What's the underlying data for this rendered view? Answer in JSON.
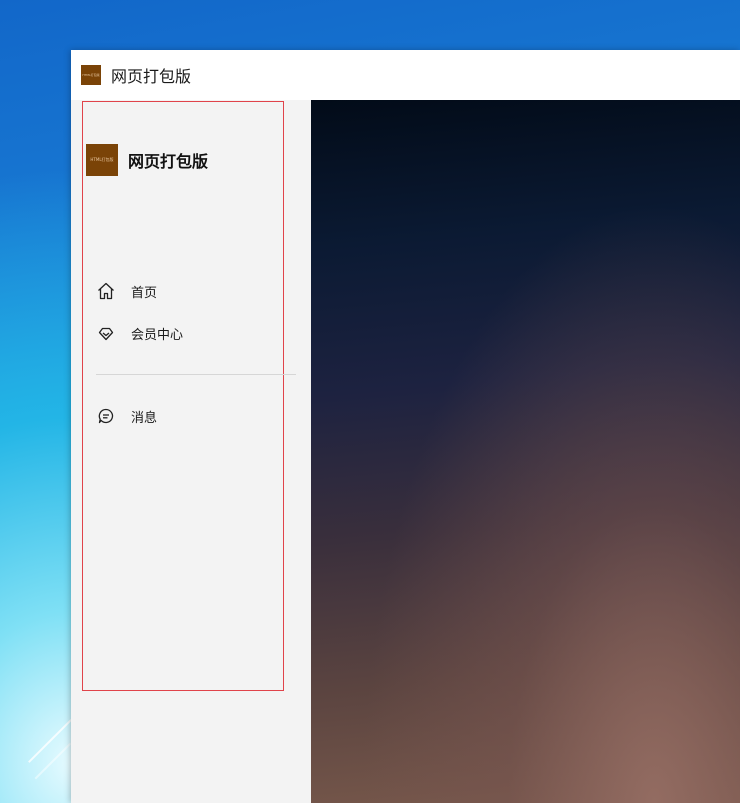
{
  "window": {
    "title": "网页打包版",
    "icon_text": "HTML打包版"
  },
  "sidebar": {
    "brand": {
      "logo_text": "HTML打包版",
      "name": "网页打包版"
    },
    "items": [
      {
        "label": "首页",
        "icon": "home-icon"
      },
      {
        "label": "会员中心",
        "icon": "diamond-icon"
      },
      {
        "label": "消息",
        "icon": "chat-bubble-icon"
      }
    ]
  },
  "colors": {
    "brand": "#7a4307",
    "sidebar_bg": "#f3f3f3",
    "outline": "#e0434a"
  }
}
